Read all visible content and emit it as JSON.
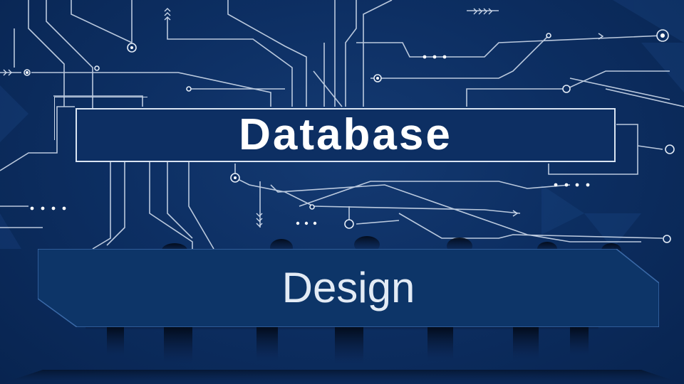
{
  "slide": {
    "title": "Database",
    "subtitle": "Design"
  },
  "colors": {
    "background": "#0b2a5c",
    "circuit_lines": "#c9d6e8",
    "subtitle_panel": "#0d3568",
    "title_text": "#ffffff"
  },
  "icons": [
    "circuit-board-background",
    "people-silhouettes"
  ]
}
